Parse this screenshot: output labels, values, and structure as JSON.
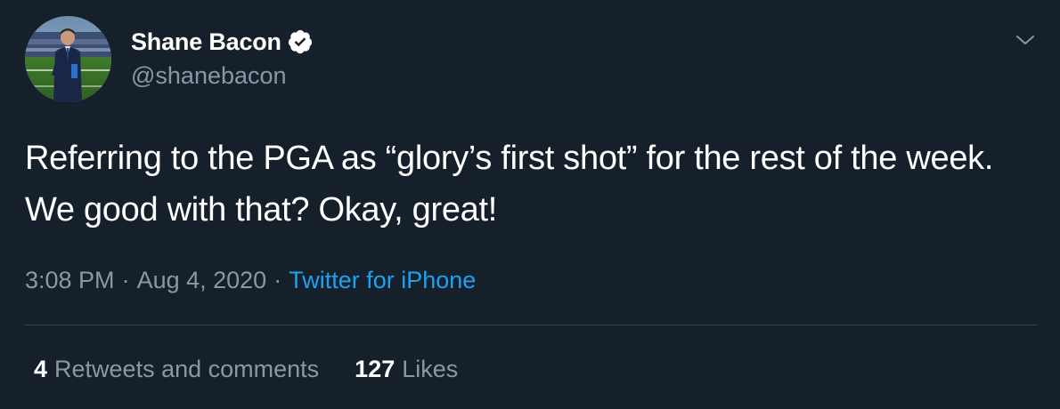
{
  "author": {
    "display_name": "Shane Bacon",
    "handle": "@shanebacon",
    "verified": true,
    "avatar": "profile-photo"
  },
  "tweet": {
    "text": "Referring to the PGA as “glory’s first shot” for the rest of the week. We good with that? Okay, great!",
    "time": "3:08 PM",
    "separator": "·",
    "date": "Aug 4, 2020",
    "source": "Twitter for iPhone"
  },
  "stats": {
    "retweets_count": "4",
    "retweets_label": "Retweets and comments",
    "likes_count": "127",
    "likes_label": "Likes"
  },
  "icons": {
    "verified": "verified-badge-icon",
    "menu": "chevron-down-icon"
  },
  "colors": {
    "background": "#15202b",
    "secondary_text": "#8899a6",
    "link": "#1da1f2",
    "divider": "#38444d"
  }
}
